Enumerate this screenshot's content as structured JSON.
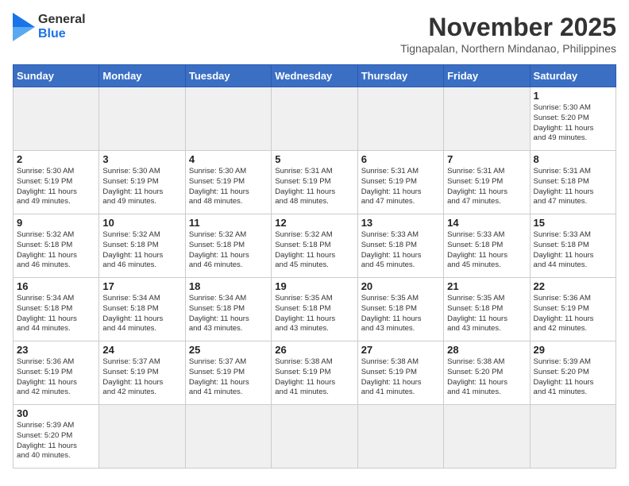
{
  "header": {
    "logo_general": "General",
    "logo_blue": "Blue",
    "month_title": "November 2025",
    "location": "Tignapalan, Northern Mindanao, Philippines"
  },
  "weekdays": [
    "Sunday",
    "Monday",
    "Tuesday",
    "Wednesday",
    "Thursday",
    "Friday",
    "Saturday"
  ],
  "days": [
    {
      "num": "",
      "info": ""
    },
    {
      "num": "",
      "info": ""
    },
    {
      "num": "",
      "info": ""
    },
    {
      "num": "",
      "info": ""
    },
    {
      "num": "",
      "info": ""
    },
    {
      "num": "",
      "info": ""
    },
    {
      "num": "1",
      "info": "Sunrise: 5:30 AM\nSunset: 5:20 PM\nDaylight: 11 hours\nand 49 minutes."
    },
    {
      "num": "2",
      "info": "Sunrise: 5:30 AM\nSunset: 5:19 PM\nDaylight: 11 hours\nand 49 minutes."
    },
    {
      "num": "3",
      "info": "Sunrise: 5:30 AM\nSunset: 5:19 PM\nDaylight: 11 hours\nand 49 minutes."
    },
    {
      "num": "4",
      "info": "Sunrise: 5:30 AM\nSunset: 5:19 PM\nDaylight: 11 hours\nand 48 minutes."
    },
    {
      "num": "5",
      "info": "Sunrise: 5:31 AM\nSunset: 5:19 PM\nDaylight: 11 hours\nand 48 minutes."
    },
    {
      "num": "6",
      "info": "Sunrise: 5:31 AM\nSunset: 5:19 PM\nDaylight: 11 hours\nand 47 minutes."
    },
    {
      "num": "7",
      "info": "Sunrise: 5:31 AM\nSunset: 5:19 PM\nDaylight: 11 hours\nand 47 minutes."
    },
    {
      "num": "8",
      "info": "Sunrise: 5:31 AM\nSunset: 5:18 PM\nDaylight: 11 hours\nand 47 minutes."
    },
    {
      "num": "9",
      "info": "Sunrise: 5:32 AM\nSunset: 5:18 PM\nDaylight: 11 hours\nand 46 minutes."
    },
    {
      "num": "10",
      "info": "Sunrise: 5:32 AM\nSunset: 5:18 PM\nDaylight: 11 hours\nand 46 minutes."
    },
    {
      "num": "11",
      "info": "Sunrise: 5:32 AM\nSunset: 5:18 PM\nDaylight: 11 hours\nand 46 minutes."
    },
    {
      "num": "12",
      "info": "Sunrise: 5:32 AM\nSunset: 5:18 PM\nDaylight: 11 hours\nand 45 minutes."
    },
    {
      "num": "13",
      "info": "Sunrise: 5:33 AM\nSunset: 5:18 PM\nDaylight: 11 hours\nand 45 minutes."
    },
    {
      "num": "14",
      "info": "Sunrise: 5:33 AM\nSunset: 5:18 PM\nDaylight: 11 hours\nand 45 minutes."
    },
    {
      "num": "15",
      "info": "Sunrise: 5:33 AM\nSunset: 5:18 PM\nDaylight: 11 hours\nand 44 minutes."
    },
    {
      "num": "16",
      "info": "Sunrise: 5:34 AM\nSunset: 5:18 PM\nDaylight: 11 hours\nand 44 minutes."
    },
    {
      "num": "17",
      "info": "Sunrise: 5:34 AM\nSunset: 5:18 PM\nDaylight: 11 hours\nand 44 minutes."
    },
    {
      "num": "18",
      "info": "Sunrise: 5:34 AM\nSunset: 5:18 PM\nDaylight: 11 hours\nand 43 minutes."
    },
    {
      "num": "19",
      "info": "Sunrise: 5:35 AM\nSunset: 5:18 PM\nDaylight: 11 hours\nand 43 minutes."
    },
    {
      "num": "20",
      "info": "Sunrise: 5:35 AM\nSunset: 5:18 PM\nDaylight: 11 hours\nand 43 minutes."
    },
    {
      "num": "21",
      "info": "Sunrise: 5:35 AM\nSunset: 5:18 PM\nDaylight: 11 hours\nand 43 minutes."
    },
    {
      "num": "22",
      "info": "Sunrise: 5:36 AM\nSunset: 5:19 PM\nDaylight: 11 hours\nand 42 minutes."
    },
    {
      "num": "23",
      "info": "Sunrise: 5:36 AM\nSunset: 5:19 PM\nDaylight: 11 hours\nand 42 minutes."
    },
    {
      "num": "24",
      "info": "Sunrise: 5:37 AM\nSunset: 5:19 PM\nDaylight: 11 hours\nand 42 minutes."
    },
    {
      "num": "25",
      "info": "Sunrise: 5:37 AM\nSunset: 5:19 PM\nDaylight: 11 hours\nand 41 minutes."
    },
    {
      "num": "26",
      "info": "Sunrise: 5:38 AM\nSunset: 5:19 PM\nDaylight: 11 hours\nand 41 minutes."
    },
    {
      "num": "27",
      "info": "Sunrise: 5:38 AM\nSunset: 5:19 PM\nDaylight: 11 hours\nand 41 minutes."
    },
    {
      "num": "28",
      "info": "Sunrise: 5:38 AM\nSunset: 5:20 PM\nDaylight: 11 hours\nand 41 minutes."
    },
    {
      "num": "29",
      "info": "Sunrise: 5:39 AM\nSunset: 5:20 PM\nDaylight: 11 hours\nand 41 minutes."
    },
    {
      "num": "30",
      "info": "Sunrise: 5:39 AM\nSunset: 5:20 PM\nDaylight: 11 hours\nand 40 minutes."
    },
    {
      "num": "",
      "info": ""
    },
    {
      "num": "",
      "info": ""
    },
    {
      "num": "",
      "info": ""
    },
    {
      "num": "",
      "info": ""
    },
    {
      "num": "",
      "info": ""
    },
    {
      "num": "",
      "info": ""
    }
  ]
}
